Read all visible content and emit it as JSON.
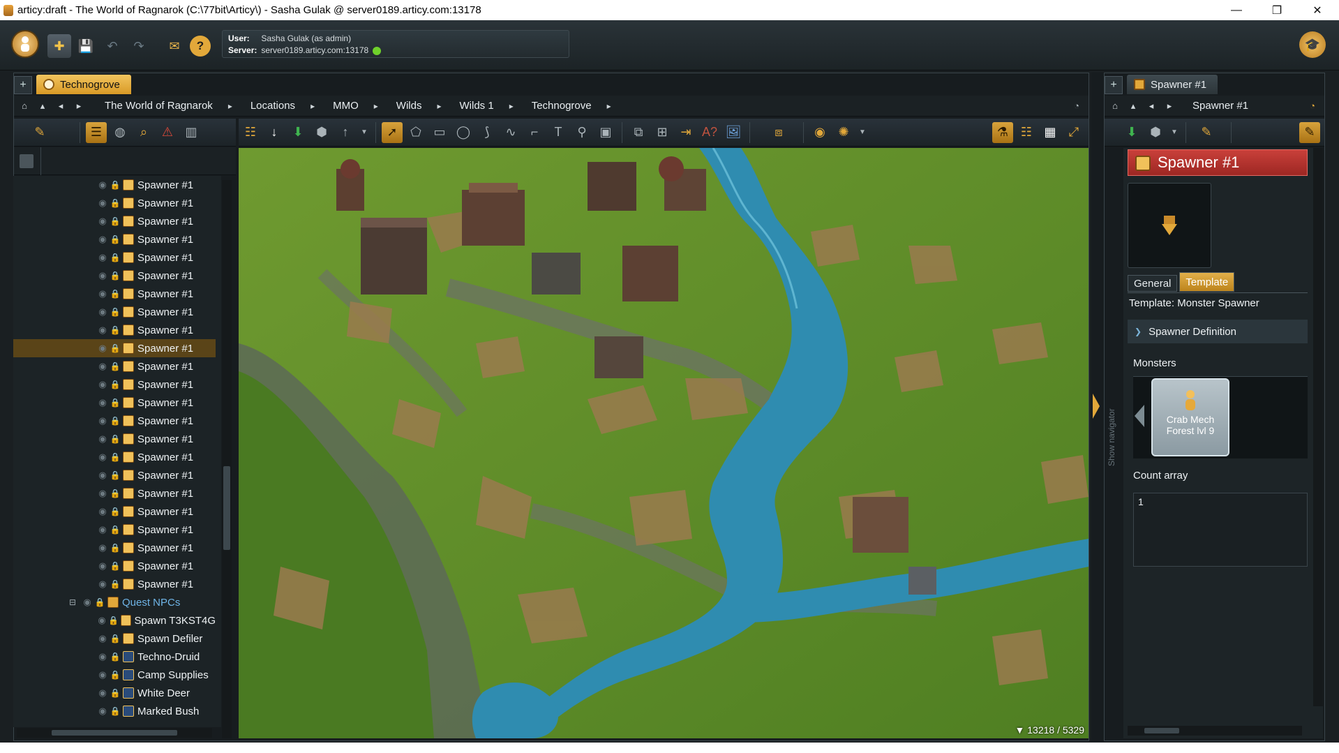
{
  "window": {
    "title": "articy:draft - The World of Ragnarok (C:\\77bit\\Articy\\) - Sasha Gulak @ server0189.articy.com:13178",
    "minimize": "—",
    "maximize": "❐",
    "close": "✕"
  },
  "toolbar": {
    "user_label": "User:",
    "user_value": "Sasha Gulak (as admin)",
    "server_label": "Server:",
    "server_value": "server0189.articy.com:13178",
    "online_color": "#6fd12b"
  },
  "left_tab": {
    "add": "+",
    "label": "Technogrove"
  },
  "breadcrumb": {
    "items": [
      "The World of Ragnarok",
      "Locations",
      "MMO",
      "Wilds",
      "Wilds 1",
      "Technogrove"
    ]
  },
  "tree": {
    "spawner_label": "Spawner #1",
    "folder_label": "Quest NPCs",
    "npcs": [
      "Spawn T3KST4G",
      "Spawn Defiler",
      "Techno-Druid",
      "Camp Supplies",
      "White Deer",
      "Marked Bush"
    ]
  },
  "map": {
    "coordinates": "▼ 13218 / 5329"
  },
  "right_tab": {
    "add": "+",
    "label": "Spawner #1",
    "breadcrumb": "Spawner #1"
  },
  "inspector": {
    "title": "Spawner #1",
    "tab_general": "General",
    "tab_template": "Template",
    "template_line": "Template: Monster Spawner",
    "section": "Spawner Definition",
    "monsters_label": "Monsters",
    "monster_name_1": "Crab Mech",
    "monster_name_2": "Forest lvl 9",
    "count_label": "Count array",
    "count_value": "1",
    "navigator_label": "Show navigator"
  },
  "colors": {
    "accent": "#e2a83a",
    "header_red": "#b3322c",
    "selected_row": "#5a4418"
  }
}
